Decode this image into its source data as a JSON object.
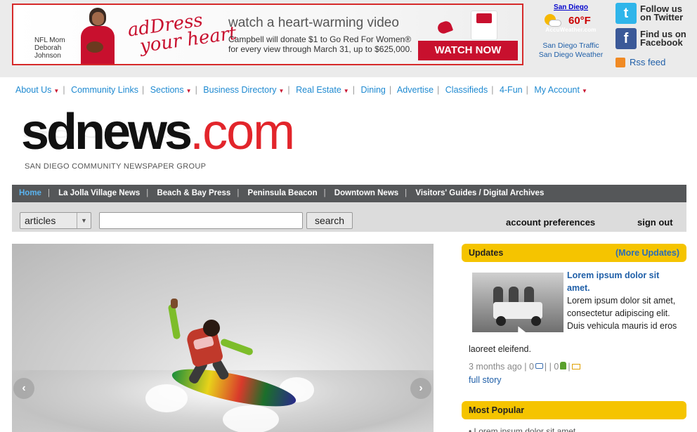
{
  "ad": {
    "nfl_line1": "NFL Mom",
    "nfl_line2": "Deborah",
    "nfl_line3": "Johnson",
    "script_line1": "adDress",
    "script_line2": "your heart",
    "headline": "watch a heart-warming video",
    "body_line1": "Campbell will donate $1 to Go Red For Women®",
    "body_line2": "for every view through March 31, up to $625,000.",
    "logo1": "Go Red",
    "logo2": "adDRESS your heart",
    "cta": "WATCH NOW"
  },
  "weather": {
    "city": "San Diego",
    "temp": "60°F",
    "brand": "AccuWeather.com",
    "traffic": "San Diego Traffic",
    "weather_link": "San Diego Weather"
  },
  "social": {
    "twitter_line1": "Follow us",
    "twitter_line2": "on Twitter",
    "facebook_line1": "Find us on",
    "facebook_line2": "Facebook",
    "rss": "Rss feed"
  },
  "navlinks": {
    "about": "About Us",
    "community": "Community Links",
    "sections": "Sections",
    "business": "Business Directory",
    "realestate": "Real Estate",
    "dining": "Dining",
    "advertise": "Advertise",
    "classifieds": "Classifieds",
    "fun": "4-Fun",
    "account": "My Account"
  },
  "logo": {
    "name": "sdnews",
    "domain": ".com",
    "tagline": "SAN DIEGO COMMUNITY NEWSPAPER GROUP"
  },
  "darknav": {
    "home": "Home",
    "lajolla": "La Jolla Village News",
    "beach": "Beach & Bay Press",
    "peninsula": "Peninsula Beacon",
    "downtown": "Downtown News",
    "visitors": "Visitors' Guides / Digital Archives"
  },
  "search": {
    "select_value": "articles",
    "input_value": "",
    "button": "search",
    "account_prefs": "account preferences",
    "signout": "sign out"
  },
  "updates": {
    "title": "Updates",
    "more": "(More Updates)",
    "story_title": "Lorem ipsum dolor sit amet.",
    "story_body": "Lorem ipsum dolor sit amet, consectetur adipiscing elit. Duis vehicula mauris id eros",
    "story_body_tail": "laoreet eleifend.",
    "meta_time": "3 months ago",
    "meta_comments": "0",
    "meta_likes": "0",
    "full_story": "full story"
  },
  "popular": {
    "title": "Most Popular",
    "first_item": "Lorem ipsum dolor sit amet"
  },
  "colors": {
    "brand_red": "#e2252b",
    "link_blue": "#1f8ad1",
    "yellow": "#f5c400",
    "dark_nav": "#555759"
  }
}
